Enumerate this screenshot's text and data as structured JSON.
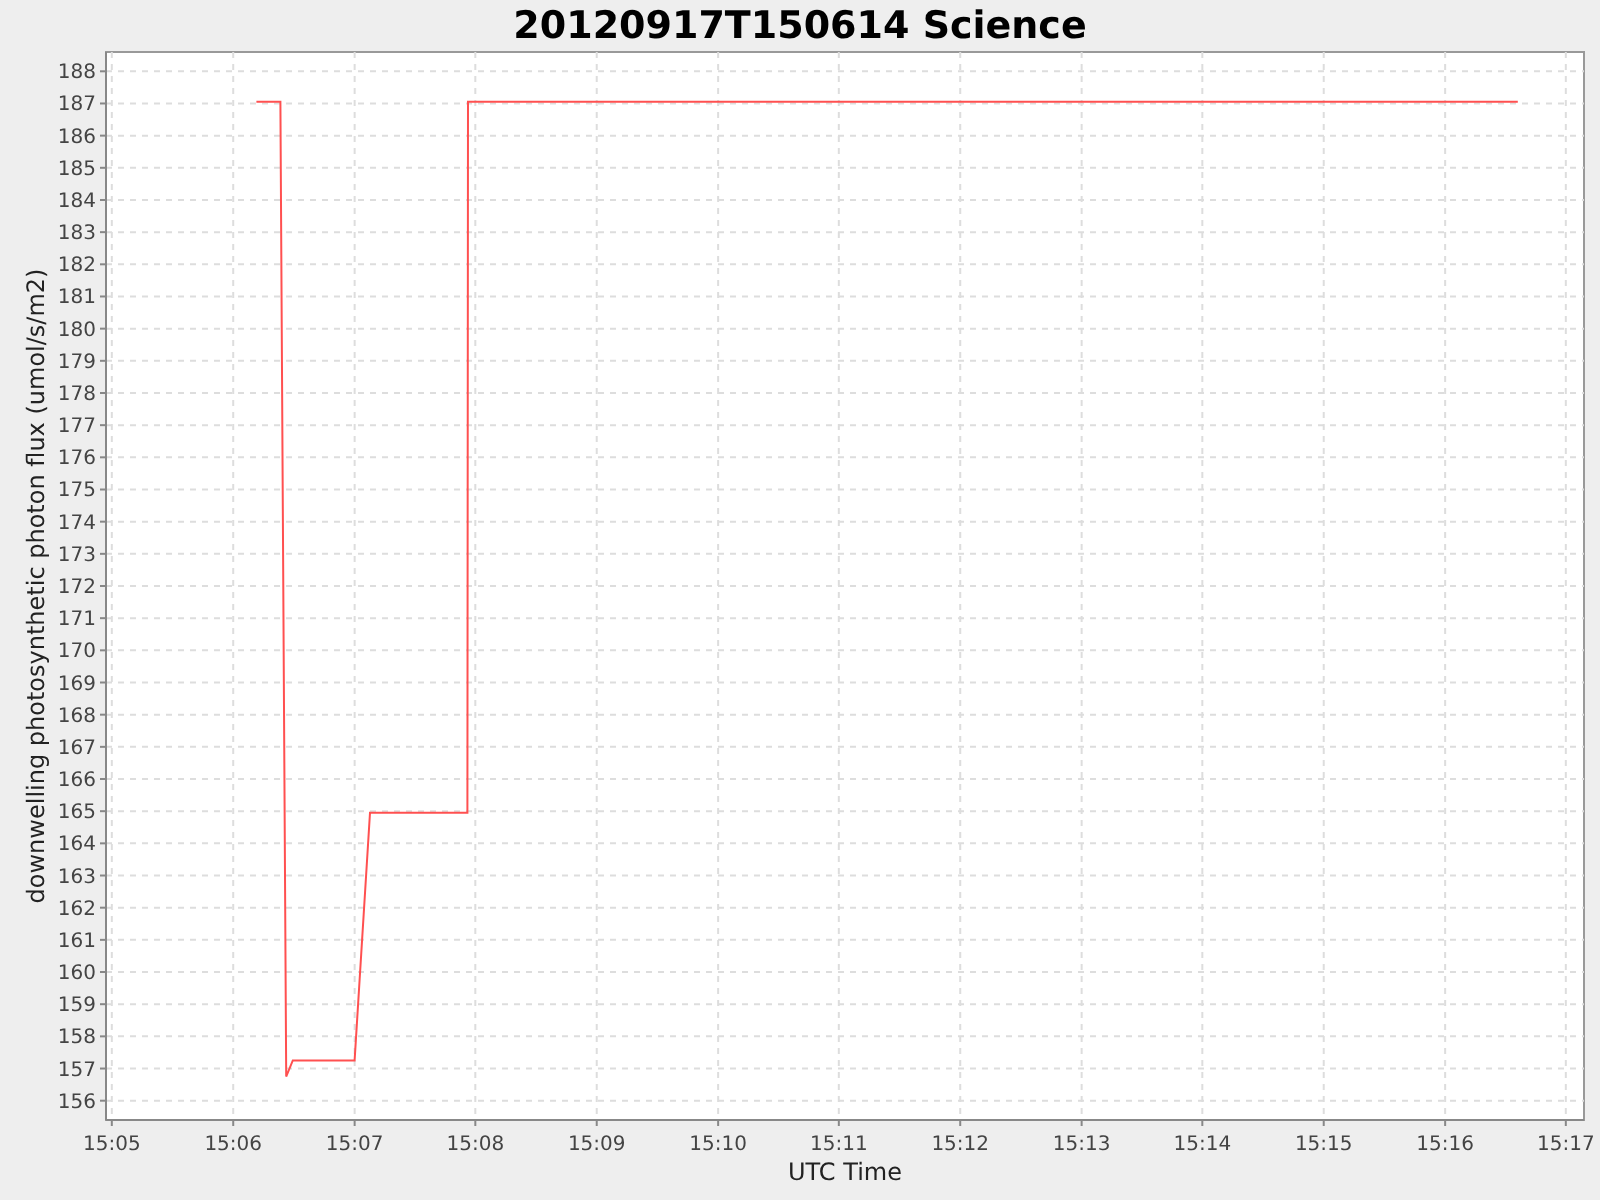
{
  "chart": {
    "chart_data": {
      "type": "line",
      "title": "20120917T150614 Science",
      "xlabel": "UTC Time",
      "ylabel": "downwelling photosynthetic photon flux (umol/s/m2)",
      "grid": true,
      "x": [
        15.1032,
        15.1065,
        15.1073,
        15.1082,
        15.1167,
        15.1188,
        15.1322,
        15.1323,
        15.2767
      ],
      "series": [
        {
          "color": "#ff5050",
          "values": [
            187.05,
            187.05,
            156.75,
            157.25,
            157.25,
            164.95,
            164.95,
            187.05,
            187.05
          ]
        }
      ],
      "xlim": [
        15.0825,
        15.2858
      ],
      "ylim": [
        155.4,
        188.6
      ],
      "xticks": [
        {
          "value": 15.0833,
          "label": "15:05"
        },
        {
          "value": 15.1,
          "label": "15:06"
        },
        {
          "value": 15.1167,
          "label": "15:07"
        },
        {
          "value": 15.1333,
          "label": "15:08"
        },
        {
          "value": 15.15,
          "label": "15:09"
        },
        {
          "value": 15.1667,
          "label": "15:10"
        },
        {
          "value": 15.1833,
          "label": "15:11"
        },
        {
          "value": 15.2,
          "label": "15:12"
        },
        {
          "value": 15.2167,
          "label": "15:13"
        },
        {
          "value": 15.2333,
          "label": "15:14"
        },
        {
          "value": 15.25,
          "label": "15:15"
        },
        {
          "value": 15.2667,
          "label": "15:16"
        },
        {
          "value": 15.2833,
          "label": "15:17"
        }
      ],
      "yticks": [
        156,
        157,
        158,
        159,
        160,
        161,
        162,
        163,
        164,
        165,
        166,
        167,
        168,
        169,
        170,
        171,
        172,
        173,
        174,
        175,
        176,
        177,
        178,
        179,
        180,
        181,
        182,
        183,
        184,
        185,
        186,
        187,
        188
      ]
    }
  }
}
